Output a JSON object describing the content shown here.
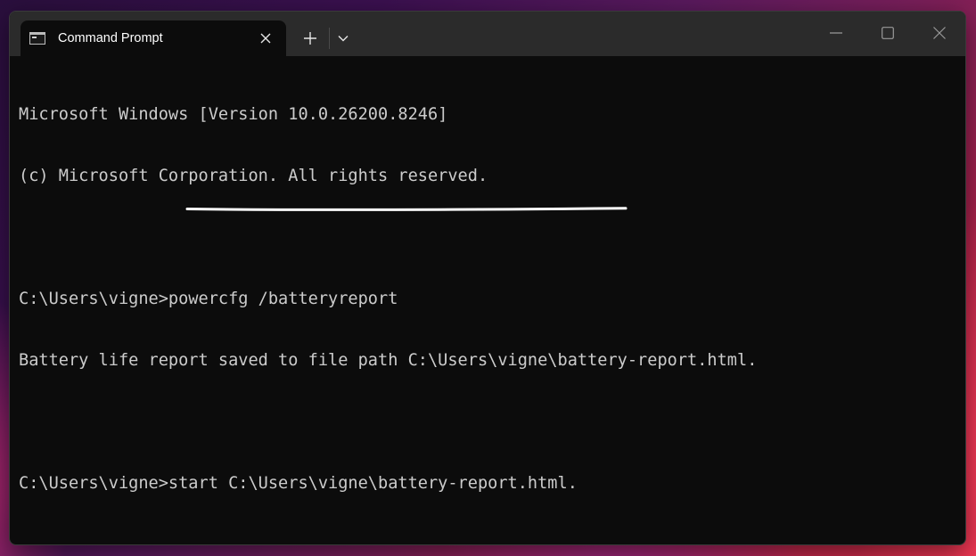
{
  "window": {
    "tab_title": "Command Prompt",
    "tab_icon": "cmd-icon",
    "close_tab_icon": "close-icon",
    "new_tab_icon": "plus-icon",
    "dropdown_icon": "chevron-down-icon",
    "minimize_icon": "minimize-icon",
    "maximize_icon": "maximize-icon",
    "close_window_icon": "close-icon"
  },
  "console": {
    "lines": [
      "Microsoft Windows [Version 10.0.26200.8246]",
      "(c) Microsoft Corporation. All rights reserved.",
      "",
      "C:\\Users\\vigne>powercfg /batteryreport",
      "Battery life report saved to file path C:\\Users\\vigne\\battery-report.html.",
      "",
      "C:\\Users\\vigne>start C:\\Users\\vigne\\battery-report.html."
    ],
    "prompt": "C:\\Users\\vigne>",
    "highlighted_command": "start C:\\Users\\vigne\\battery-report.html."
  },
  "colors": {
    "console_bg": "#0c0c0c",
    "console_text": "#cccccc",
    "titlebar_bg": "#2b2b2b",
    "underline": "#ffffff"
  }
}
